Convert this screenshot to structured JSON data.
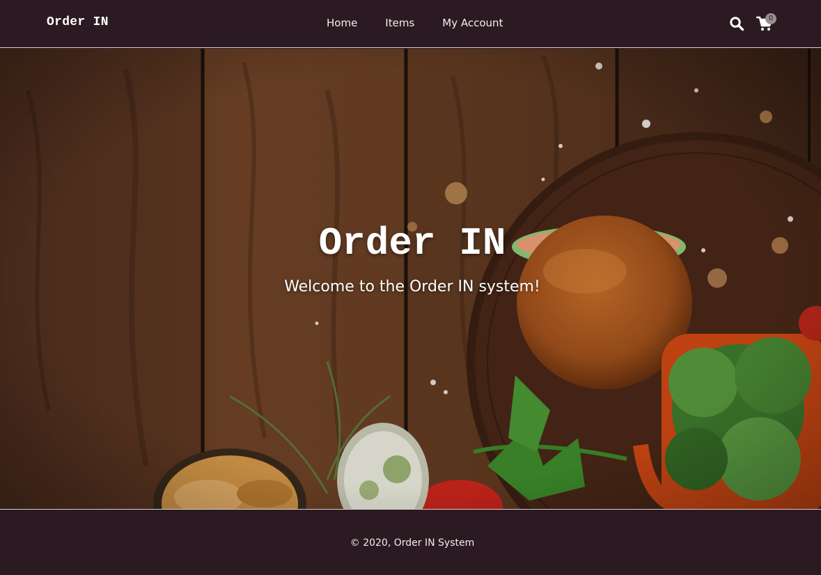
{
  "header": {
    "brand": "Order IN",
    "nav": {
      "home": "Home",
      "items": "Items",
      "account": "My Account"
    },
    "icons": {
      "search": "search-icon",
      "cart": "cart-icon"
    },
    "cart_count": "0"
  },
  "hero": {
    "title": "Order IN",
    "subtitle": "Welcome to the Order IN system!"
  },
  "footer": {
    "copyright": "© 2020, Order IN System"
  },
  "colors": {
    "header_bg": "#2b1a21",
    "footer_bg": "#2b1a21",
    "text": "#ffffff",
    "badge": "#9a8d92"
  }
}
